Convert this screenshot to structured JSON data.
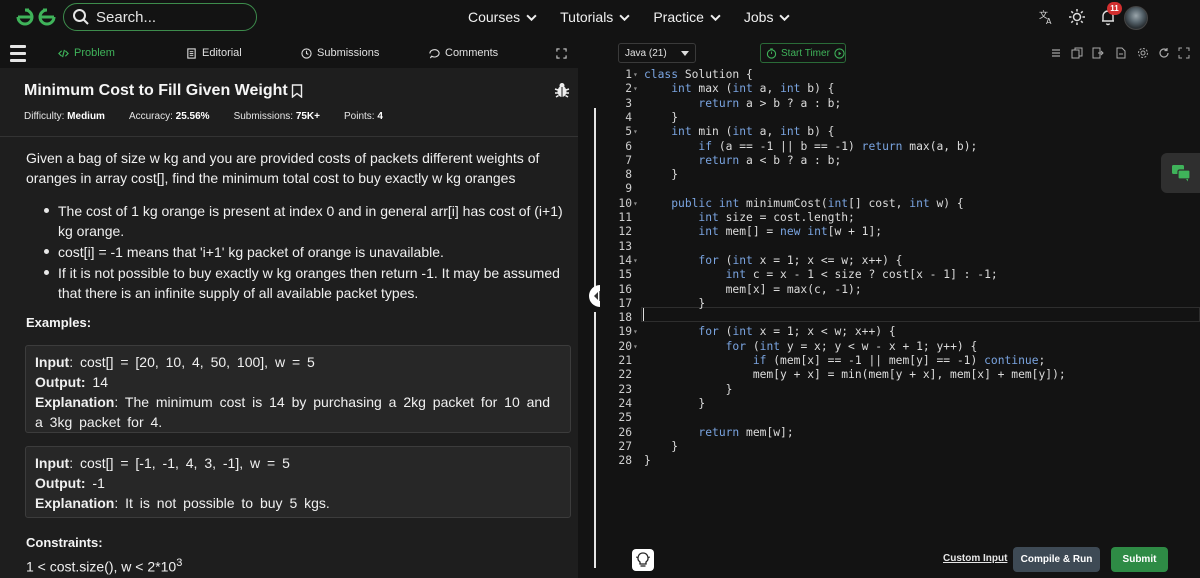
{
  "nav": {
    "search_placeholder": "Search...",
    "links": [
      "Courses",
      "Tutorials",
      "Practice",
      "Jobs"
    ],
    "notification_count": "11"
  },
  "tabs": {
    "problem": "Problem",
    "editorial": "Editorial",
    "submissions": "Submissions",
    "comments": "Comments"
  },
  "problem": {
    "title": "Minimum Cost to Fill Given Weight",
    "difficulty_label": "Difficulty:",
    "difficulty": "Medium",
    "accuracy_label": "Accuracy:",
    "accuracy": "25.56%",
    "submissions_label": "Submissions:",
    "submissions": "75K+",
    "points_label": "Points:",
    "points": "4",
    "description": "Given a bag of size w kg and you are provided costs of packets different weights of oranges in array cost[], find the minimum total cost to buy exactly w kg oranges",
    "bullets": [
      "The cost of 1 kg orange is present at index 0 and in general arr[i] has cost of (i+1) kg orange.",
      "cost[i] = -1 means that 'i+1' kg packet of orange is unavailable.",
      "If it is not possible to buy exactly w kg oranges then return -1. It may be assumed that there is an infinite supply of all available packet types."
    ],
    "examples_heading": "Examples:",
    "example1": {
      "input_label": "Input",
      "input": ": cost[] = [20, 10, 4, 50, 100], w = 5",
      "output_label": "Output:",
      "output": " 14",
      "explanation_label": "Explanation",
      "explanation": ": The minimum cost is 14 by purchasing a 2kg packet for 10 and a 3kg packet for 4."
    },
    "example2": {
      "input_label": "Input",
      "input": ": cost[] = [-1, -1, 4, 3, -1], w = 5",
      "output_label": "Output:",
      "output": " -1",
      "explanation_label": "Explanation",
      "explanation": ": It is not possible to buy 5 kgs."
    },
    "constraints_heading": "Constraints:",
    "constraint_text": "1 < cost.size(), w < 2*10",
    "constraint_exp": "3"
  },
  "editor": {
    "language": "Java (21)",
    "timer_label": "Start Timer",
    "line_numbers": [
      "1",
      "2",
      "3",
      "4",
      "5",
      "6",
      "7",
      "8",
      "9",
      "10",
      "11",
      "12",
      "13",
      "14",
      "15",
      "16",
      "17",
      "18",
      "19",
      "20",
      "21",
      "22",
      "23",
      "24",
      "25",
      "26",
      "27",
      "28"
    ],
    "lines": [
      "class Solution {",
      "    int max (int a, int b) {",
      "        return a > b ? a : b;",
      "    }",
      "    int min (int a, int b) {",
      "        if (a == -1 || b == -1) return max(a, b);",
      "        return a < b ? a : b;",
      "    }",
      "",
      "    public int minimumCost(int[] cost, int w) {",
      "        int size = cost.length;",
      "        int mem[] = new int[w + 1];",
      "",
      "        for (int x = 1; x <= w; x++) {",
      "            int c = x - 1 < size ? cost[x - 1] : -1;",
      "            mem[x] = max(c, -1);",
      "        }",
      "",
      "        for (int x = 1; x < w; x++) {",
      "            for (int y = x; y < w - x + 1; y++) {",
      "                if (mem[x] == -1 || mem[y] == -1) continue;",
      "                mem[y + x] = min(mem[y + x], mem[x] + mem[y]);",
      "            }",
      "        }",
      "",
      "        return mem[w];",
      "    }",
      "}"
    ]
  },
  "footer": {
    "custom_input": "Custom Input",
    "compile_run": "Compile & Run",
    "submit": "Submit"
  }
}
